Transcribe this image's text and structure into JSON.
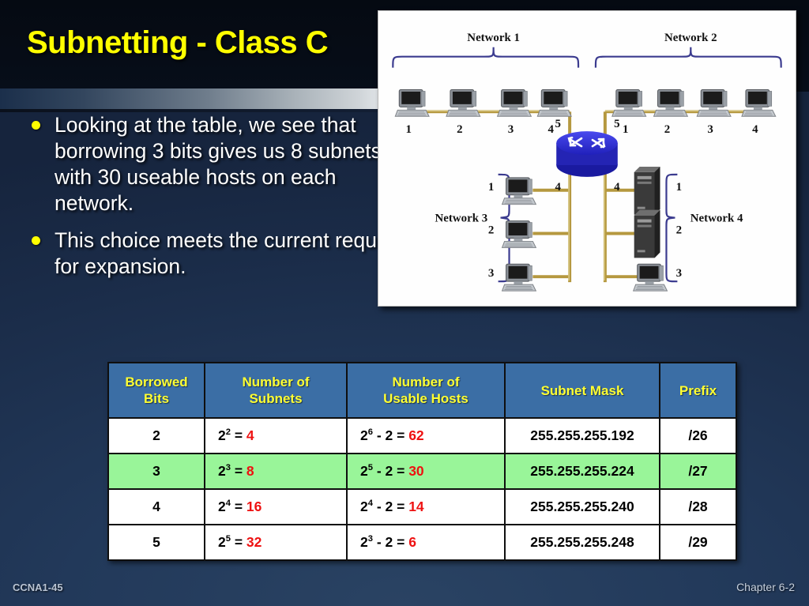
{
  "slide": {
    "title": "Subnetting - Class C",
    "accent_color": "#ffff00",
    "background_color": "#1d3350"
  },
  "bullets": [
    {
      "text": "Looking at the table, we see that borrowing 3 bits gives us 8 subnets with 30 useable hosts on each network."
    },
    {
      "text": "This choice meets the current requirements and leaves room for expansion."
    }
  ],
  "figure": {
    "alt": "network-diagram-four-subnets",
    "networks": [
      {
        "label": "Network 1",
        "hosts": [
          "1",
          "2",
          "3",
          "4"
        ],
        "router_port": "5"
      },
      {
        "label": "Network 2",
        "hosts": [
          "1",
          "2",
          "3",
          "4"
        ],
        "router_port": "5"
      },
      {
        "label": "Network 3",
        "hosts": [
          "1",
          "2",
          "3"
        ],
        "router_port": "4"
      },
      {
        "label": "Network 4",
        "hosts": [
          "1",
          "2",
          "3"
        ],
        "router_port": "4"
      }
    ],
    "router_color": "#2222cc",
    "cable_color": "#b5983f"
  },
  "table": {
    "headers": [
      "Borrowed\nBits",
      "Number of\nSubnets",
      "Number of\nUsable Hosts",
      "Subnet Mask",
      "Prefix"
    ],
    "header_bg": "#3b6ea5",
    "header_color": "#ffff33",
    "highlight_bg": "#99f599",
    "value_color": "#ee1111",
    "rows": [
      {
        "borrowed_bits": "2",
        "subnets_base": "2",
        "subnets_exp": "2",
        "subnets_eq": "=",
        "subnets_value": "4",
        "hosts_base": "2",
        "hosts_exp": "6",
        "hosts_minus": "-  2  =",
        "hosts_value": "62",
        "subnet_mask": "255.255.255.192",
        "prefix": "/26",
        "highlighted": false
      },
      {
        "borrowed_bits": "3",
        "subnets_base": "2",
        "subnets_exp": "3",
        "subnets_eq": "=",
        "subnets_value": "8",
        "hosts_base": "2",
        "hosts_exp": "5",
        "hosts_minus": "-  2  =",
        "hosts_value": "30",
        "subnet_mask": "255.255.255.224",
        "prefix": "/27",
        "highlighted": true
      },
      {
        "borrowed_bits": "4",
        "subnets_base": "2",
        "subnets_exp": "4",
        "subnets_eq": "=",
        "subnets_value": "16",
        "hosts_base": "2",
        "hosts_exp": "4",
        "hosts_minus": "-  2  =",
        "hosts_value": "14",
        "subnet_mask": "255.255.255.240",
        "prefix": "/28",
        "highlighted": false
      },
      {
        "borrowed_bits": "5",
        "subnets_base": "2",
        "subnets_exp": "5",
        "subnets_eq": "=",
        "subnets_value": "32",
        "hosts_base": "2",
        "hosts_exp": "3",
        "hosts_minus": "-  2  =",
        "hosts_value": "6",
        "subnet_mask": "255.255.255.248",
        "prefix": "/29",
        "highlighted": false
      }
    ]
  },
  "footer": {
    "left": "CCNA1-45",
    "right": "Chapter 6-2"
  }
}
